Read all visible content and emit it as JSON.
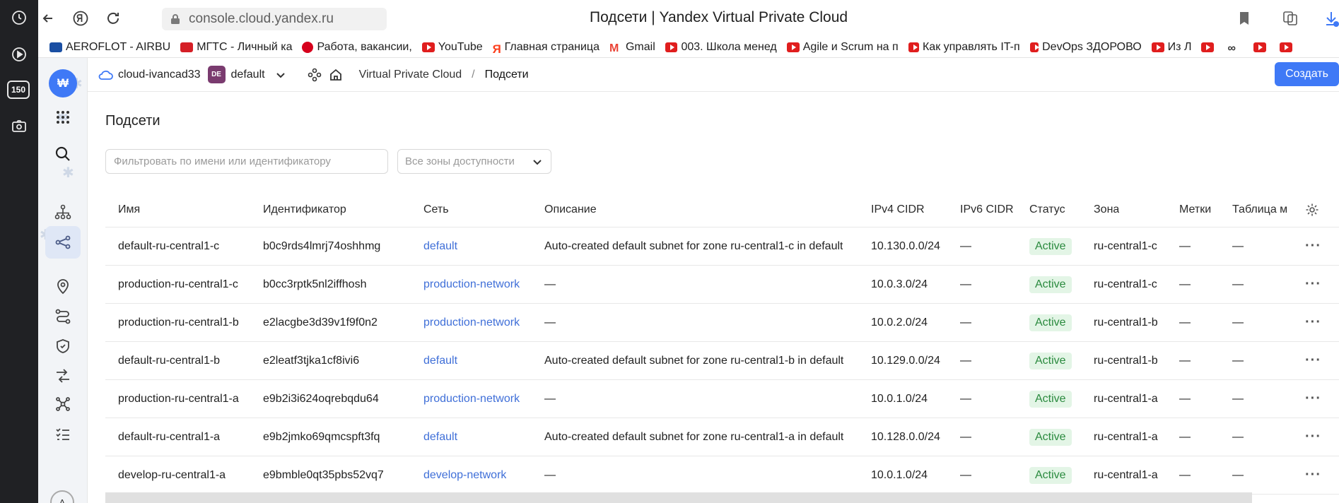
{
  "browser": {
    "url": "console.cloud.yandex.ru",
    "tab_title": "Подсети | Yandex Virtual Private Cloud",
    "dock_badge": "150",
    "bookmarks": [
      {
        "label": "AEROFLOT - AIRBU",
        "icon": "aeroflot-icon"
      },
      {
        "label": "МГТС - Личный ка",
        "icon": "mgts-icon"
      },
      {
        "label": "Работа, вакансии,",
        "icon": "hh-icon"
      },
      {
        "label": "YouTube",
        "icon": "youtube-icon"
      },
      {
        "label": "Главная страница",
        "icon": "yandex-icon"
      },
      {
        "label": "Gmail",
        "icon": "gmail-icon"
      },
      {
        "label": "003. Школа менед",
        "icon": "youtube-icon"
      },
      {
        "label": "Agile и Scrum на п",
        "icon": "youtube-icon"
      },
      {
        "label": "Как управлять IT-п",
        "icon": "youtube-icon"
      },
      {
        "label": "DevOps ЗДОРОВО",
        "icon": "youtube-icon"
      },
      {
        "label": "Из Л",
        "icon": "youtube-icon"
      }
    ]
  },
  "header": {
    "cloud_name": "cloud-ivancad33",
    "folder_badge": "DE",
    "folder_name": "default",
    "breadcrumb_service": "Virtual Private Cloud",
    "breadcrumb_separator": "/",
    "breadcrumb_current": "Подсети",
    "create_label": "Создать"
  },
  "rail": {
    "logo": "₩",
    "avatar": "A"
  },
  "page": {
    "title": "Подсети",
    "filter_placeholder": "Фильтровать по имени или идентификатору",
    "zone_select": "Все зоны доступности"
  },
  "table": {
    "columns": [
      "Имя",
      "Идентификатор",
      "Сеть",
      "Описание",
      "IPv4 CIDR",
      "IPv6 CIDR",
      "Статус",
      "Зона",
      "Метки",
      "Таблица м"
    ],
    "rows": [
      {
        "name": "default-ru-central1-c",
        "id": "b0c9rds4lmrj74oshhmg",
        "network": "default",
        "description": "Auto-created default subnet for zone ru-central1-c in default",
        "ipv4": "10.130.0.0/24",
        "ipv6": "—",
        "status": "Active",
        "zone": "ru-central1-c",
        "labels": "—",
        "route_table": "—"
      },
      {
        "name": "production-ru-central1-c",
        "id": "b0cc3rptk5nl2iffhosh",
        "network": "production-network",
        "description": "—",
        "ipv4": "10.0.3.0/24",
        "ipv6": "—",
        "status": "Active",
        "zone": "ru-central1-c",
        "labels": "—",
        "route_table": "—"
      },
      {
        "name": "production-ru-central1-b",
        "id": "e2lacgbe3d39v1f9f0n2",
        "network": "production-network",
        "description": "—",
        "ipv4": "10.0.2.0/24",
        "ipv6": "—",
        "status": "Active",
        "zone": "ru-central1-b",
        "labels": "—",
        "route_table": "—"
      },
      {
        "name": "default-ru-central1-b",
        "id": "e2leatf3tjka1cf8ivi6",
        "network": "default",
        "description": "Auto-created default subnet for zone ru-central1-b in default",
        "ipv4": "10.129.0.0/24",
        "ipv6": "—",
        "status": "Active",
        "zone": "ru-central1-b",
        "labels": "—",
        "route_table": "—"
      },
      {
        "name": "production-ru-central1-a",
        "id": "e9b2i3i624oqrebqdu64",
        "network": "production-network",
        "description": "—",
        "ipv4": "10.0.1.0/24",
        "ipv6": "—",
        "status": "Active",
        "zone": "ru-central1-a",
        "labels": "—",
        "route_table": "—"
      },
      {
        "name": "default-ru-central1-a",
        "id": "e9b2jmko69qmcspft3fq",
        "network": "default",
        "description": "Auto-created default subnet for zone ru-central1-a in default",
        "ipv4": "10.128.0.0/24",
        "ipv6": "—",
        "status": "Active",
        "zone": "ru-central1-a",
        "labels": "—",
        "route_table": "—"
      },
      {
        "name": "develop-ru-central1-a",
        "id": "e9bmble0qt35pbs52vq7",
        "network": "develop-network",
        "description": "—",
        "ipv4": "10.0.1.0/24",
        "ipv6": "—",
        "status": "Active",
        "zone": "ru-central1-a",
        "labels": "—",
        "route_table": "—"
      }
    ]
  },
  "colors": {
    "accent": "#3f79f6",
    "link": "#3f6fd8",
    "status_bg": "#e3f5e6",
    "status_text": "#2a8a3e"
  }
}
